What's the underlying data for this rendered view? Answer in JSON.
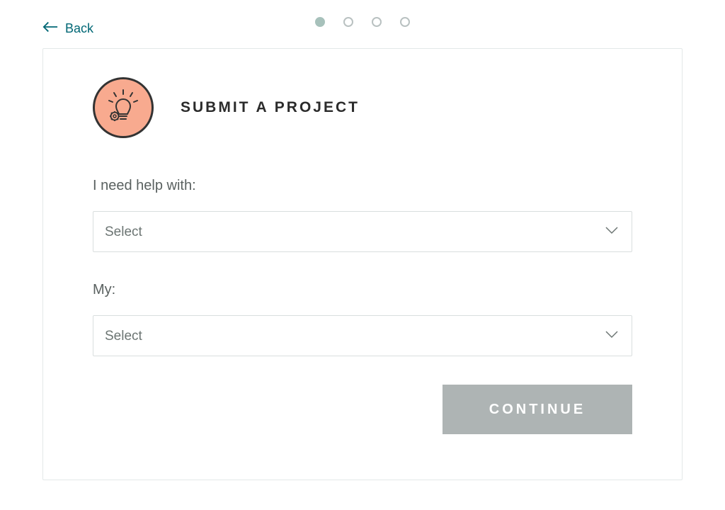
{
  "nav": {
    "back_label": "Back"
  },
  "stepper": {
    "total": 4,
    "active_index": 0
  },
  "header": {
    "title": "SUBMIT A PROJECT",
    "icon": "lightbulb-gear-icon"
  },
  "form": {
    "help_label": "I need help with:",
    "help_selected": "Select",
    "my_label": "My:",
    "my_selected": "Select"
  },
  "actions": {
    "continue_label": "CONTINUE"
  },
  "colors": {
    "accent_teal": "#006775",
    "icon_bg": "#f8aa8f",
    "button_disabled": "#aeb4b4",
    "step_active": "#a7c1bb"
  }
}
